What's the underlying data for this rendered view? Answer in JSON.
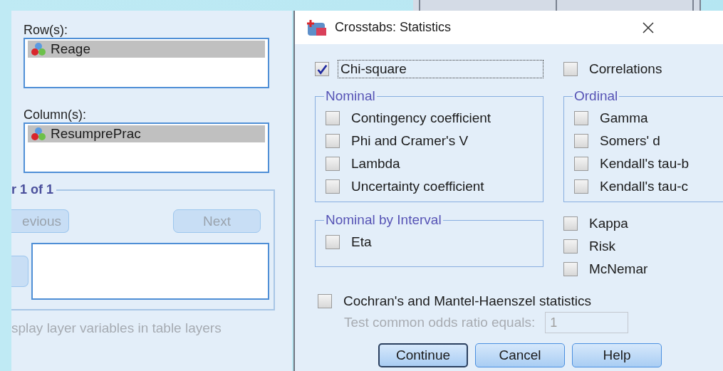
{
  "left_panel": {
    "rows_label": "Row(s):",
    "rows": [
      {
        "name": "Reage",
        "selected": true
      }
    ],
    "columns_label": "Column(s):",
    "columns": [
      {
        "name": "ResumprePrac",
        "selected": true
      }
    ],
    "layer": {
      "legend": "r 1 of 1",
      "previous_button": {
        "label": "evious",
        "disabled": true
      },
      "next_button": {
        "label": "Next",
        "disabled": true
      }
    },
    "display_layer": {
      "label": "splay layer variables in table layers",
      "disabled": true
    }
  },
  "dialog": {
    "title": "Crosstabs: Statistics",
    "chi_square": {
      "label": "Chi-square",
      "checked": true,
      "focused": true
    },
    "correlations": {
      "label": "Correlations",
      "checked": false
    },
    "nominal": {
      "title": "Nominal",
      "items": [
        {
          "label": "Contingency coefficient",
          "checked": false
        },
        {
          "label": "Phi and Cramer's V",
          "checked": false
        },
        {
          "label": "Lambda",
          "checked": false
        },
        {
          "label": "Uncertainty coefficient",
          "checked": false
        }
      ]
    },
    "ordinal": {
      "title": "Ordinal",
      "items": [
        {
          "label": "Gamma",
          "checked": false
        },
        {
          "label": "Somers' d",
          "checked": false
        },
        {
          "label": "Kendall's tau-b",
          "checked": false
        },
        {
          "label": "Kendall's tau-c",
          "checked": false
        }
      ]
    },
    "nominal_by_interval": {
      "title": "Nominal by Interval",
      "items": [
        {
          "label": "Eta",
          "checked": false
        }
      ]
    },
    "other": [
      {
        "label": "Kappa",
        "checked": false
      },
      {
        "label": "Risk",
        "checked": false
      },
      {
        "label": "McNemar",
        "checked": false
      }
    ],
    "cochran": {
      "label": "Cochran's and Mantel-Haenszel statistics",
      "checked": false
    },
    "odds_ratio": {
      "label": "Test common odds ratio equals:",
      "value": "1",
      "disabled": true
    },
    "buttons": [
      {
        "label": "Continue",
        "default": true
      },
      {
        "label": "Cancel",
        "default": false
      },
      {
        "label": "Help",
        "default": false
      }
    ]
  }
}
